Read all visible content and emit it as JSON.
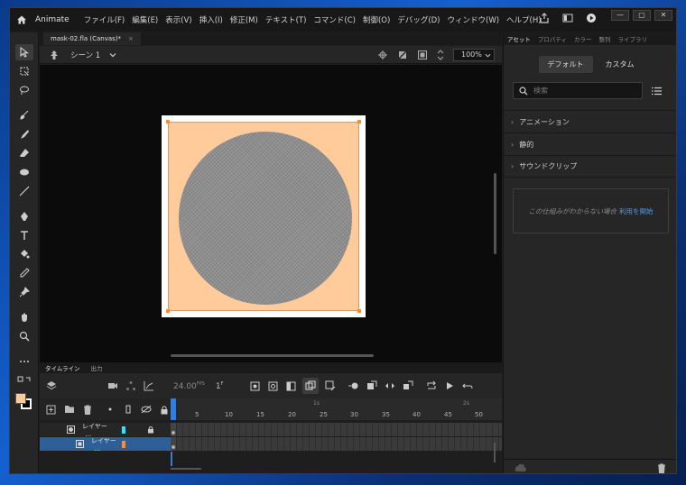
{
  "app": {
    "name": "Animate",
    "menu": [
      "ファイル(F)",
      "編集(E)",
      "表示(V)",
      "挿入(I)",
      "修正(M)",
      "テキスト(T)",
      "コマンド(C)",
      "制御(O)",
      "デバッグ(D)",
      "ウィンドウ(W)",
      "ヘルプ(H)"
    ]
  },
  "document": {
    "tab_title": "mask-02.fla (Canvas)*",
    "tab_close": "×",
    "scene": "シーン 1",
    "zoom": "100%"
  },
  "stage": {
    "canvas_color": "#ffffff",
    "rect_color": "#ffcb9a",
    "circle_color": "#8f8f8f"
  },
  "timeline": {
    "tabs": [
      "タイムライン",
      "出力"
    ],
    "fps": "24.00",
    "fps_unit": "FPS",
    "current_frame": "1",
    "frame_unit": "F",
    "ruler_ticks": [
      "5",
      "10",
      "15",
      "20",
      "25",
      "30",
      "35",
      "40",
      "45",
      "50"
    ],
    "seconds": [
      "1s",
      "2s"
    ],
    "layers": [
      {
        "name": "レイヤー_...",
        "color": "#2ee6ff",
        "locked": true
      },
      {
        "name": "レイヤー_...",
        "color": "#ff8b2e",
        "locked": false
      }
    ]
  },
  "assets": {
    "tabs": [
      "アセット",
      "プロパティ",
      "カラー",
      "整列",
      "ライブラリ"
    ],
    "segments": [
      "デフォルト",
      "カスタム"
    ],
    "search_placeholder": "検索",
    "sections": [
      "アニメーション",
      "静的",
      "サウンドクリップ"
    ],
    "help_text": "この仕組みがわからない場合",
    "help_link": "利用を開始"
  },
  "colors": {
    "accent": "#2f7de6",
    "fill_swatch": "#ffcb9a",
    "stroke_swatch": "#000000"
  }
}
